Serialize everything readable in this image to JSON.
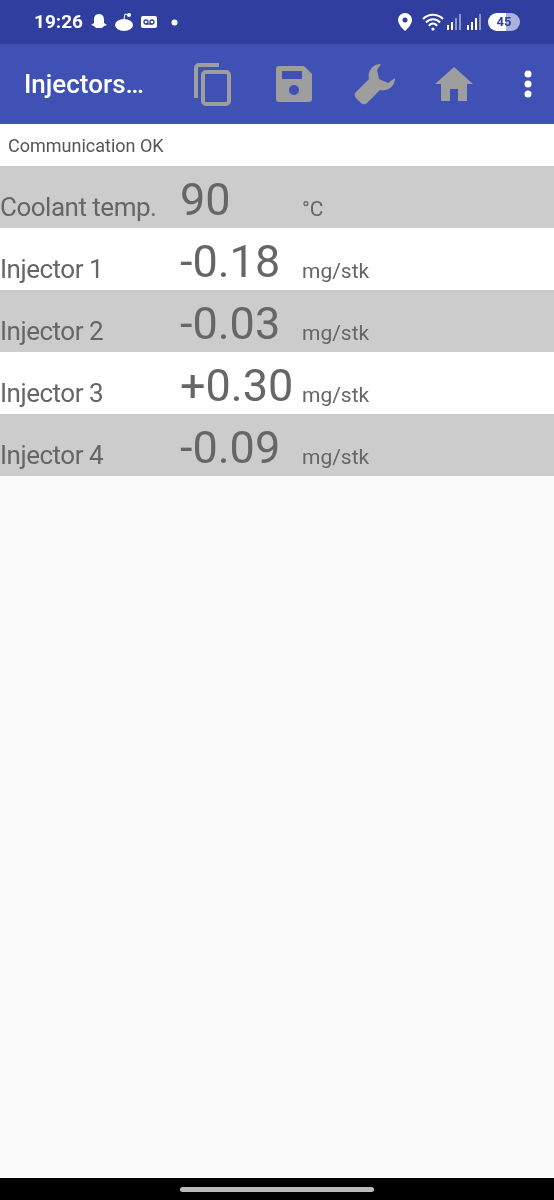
{
  "status_bar": {
    "time": "19:26",
    "battery": "45"
  },
  "app_bar": {
    "title": "Injectors…"
  },
  "status_message": "Communication OK",
  "readings": [
    {
      "label": "Coolant temp.",
      "value": "90",
      "unit": "°C"
    },
    {
      "label": "Injector 1",
      "value": "-0.18",
      "unit": "mg/stk"
    },
    {
      "label": "Injector 2",
      "value": "-0.03",
      "unit": "mg/stk"
    },
    {
      "label": "Injector 3",
      "value": "+0.30",
      "unit": "mg/stk"
    },
    {
      "label": "Injector 4",
      "value": "-0.09",
      "unit": "mg/stk"
    }
  ]
}
